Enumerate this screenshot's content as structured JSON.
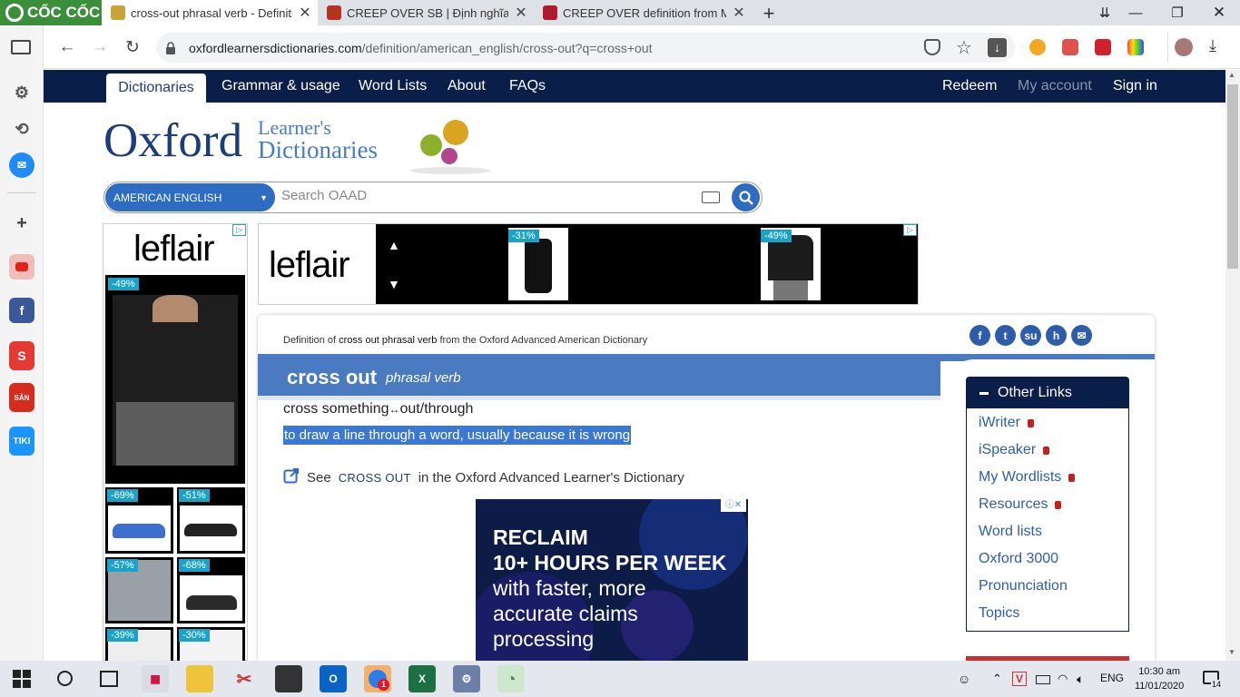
{
  "browser": {
    "brand": "CỐC CỐC",
    "tabs": [
      {
        "title": "cross-out phrasal verb - Definition",
        "active": true
      },
      {
        "title": "CREEP OVER SB | Định nghĩa trong",
        "active": false
      },
      {
        "title": "CREEP OVER definition from Macm",
        "active": false
      }
    ],
    "new_tab": "+",
    "url_domain": "oxfordlearnersdictionaries.com",
    "url_path": "/definition/american_english/cross-out?q=cross+out"
  },
  "site": {
    "nav_left": [
      "Dictionaries",
      "Grammar & usage",
      "Word Lists",
      "About",
      "FAQs"
    ],
    "nav_right": [
      "Redeem",
      "My account",
      "Sign in"
    ],
    "logo_main": "Oxford",
    "logo_sub1": "Learner's",
    "logo_sub2": "Dictionaries",
    "language": "AMERICAN ENGLISH",
    "search_placeholder": "Search OAAD"
  },
  "ads": {
    "brand": "leflair",
    "left_discounts": [
      "-49%",
      "-69%",
      "-51%",
      "-57%",
      "-68%",
      "-39%",
      "-30%"
    ],
    "top_discounts": [
      "-31%",
      "-49%"
    ],
    "inner_lines": [
      "RECLAIM",
      "10+ HOURS PER WEEK",
      "with faster, more",
      "accurate claims",
      "processing"
    ]
  },
  "entry": {
    "definition_of_prefix": "Definition of",
    "definition_of_term": "cross out phrasal verb",
    "definition_of_suffix": "from the Oxford Advanced American Dictionary",
    "headword": "cross out",
    "pos": "phrasal verb",
    "cf_a": "cross something",
    "cf_swap": "↔",
    "cf_b": "out/through",
    "definition": "to draw a line through a word, usually because it is wrong",
    "see_prefix": "See",
    "see_term": "CROSS OUT",
    "see_suffix": "in the Oxford Advanced Learner's Dictionary"
  },
  "other_links": {
    "title": "Other Links",
    "items": [
      {
        "label": "iWriter",
        "locked": true
      },
      {
        "label": "iSpeaker",
        "locked": true
      },
      {
        "label": "My Wordlists",
        "locked": true
      },
      {
        "label": "Resources",
        "locked": true
      },
      {
        "label": "Word lists",
        "locked": false
      },
      {
        "label": "Oxford 3000",
        "locked": false
      },
      {
        "label": "Pronunciation",
        "locked": false
      },
      {
        "label": "Topics",
        "locked": false
      }
    ]
  },
  "taskbar": {
    "language": "ENG",
    "time": "10:30 am",
    "date": "11/01/2020",
    "notif_count": "14",
    "zalo_badge": "1"
  },
  "colors": {
    "oxford_navy": "#0a1e4a",
    "oxford_blue": "#4a7bc0",
    "brand_green": "#3c8f3a"
  }
}
